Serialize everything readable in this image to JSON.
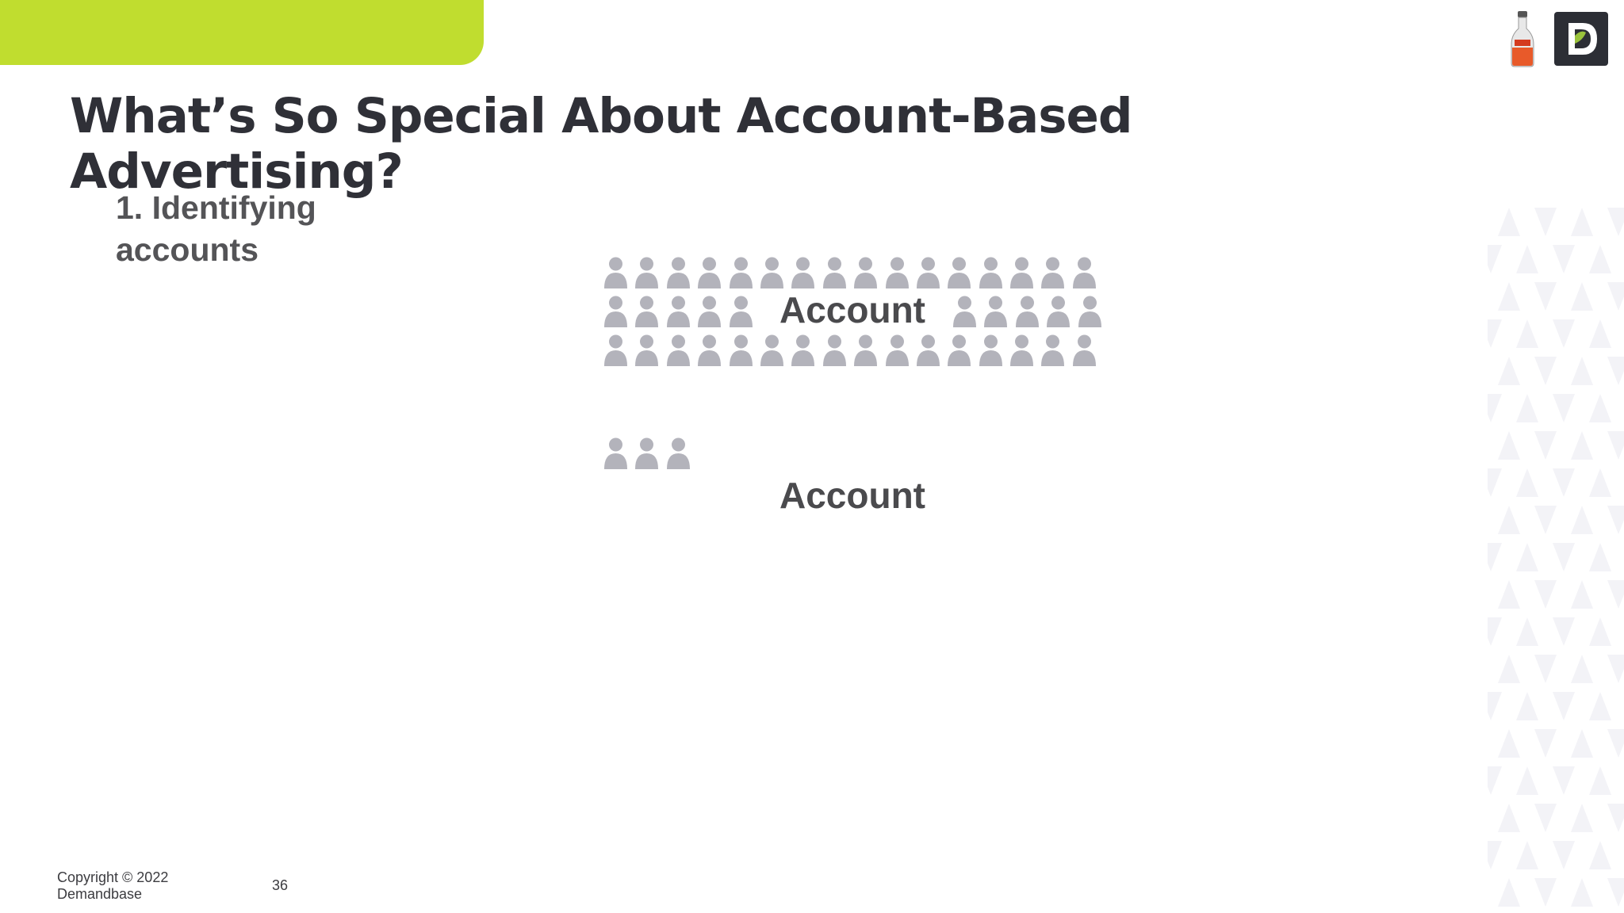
{
  "slide": {
    "title": "What’s So Special About Account-Based Advertising?",
    "subtitle": "1. Identifying accounts",
    "account_label_1": "Account",
    "account_label_2": "Account",
    "footer_copyright": "Copyright © 2022 Demandbase",
    "page_number": "36"
  },
  "colors": {
    "accent": "#c0dd2f",
    "title": "#2f3037",
    "person_icon": "#b3b3bb"
  },
  "icons": {
    "brand_logo": "demandbase-d-logo",
    "bottle_logo": "bottle-icon",
    "person": "person-icon"
  }
}
